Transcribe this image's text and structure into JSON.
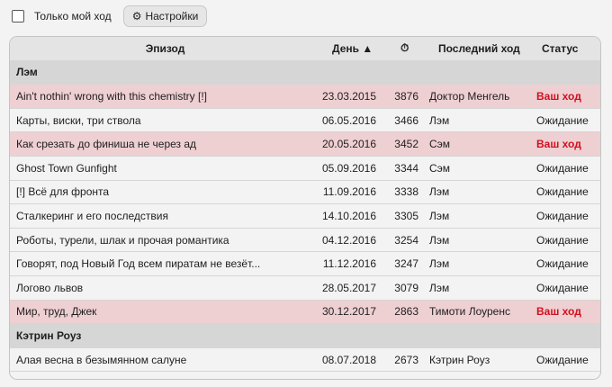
{
  "toolbar": {
    "only_my_turn_label": "Только мой ход",
    "settings_label": "Настройки"
  },
  "columns": {
    "episode": "Эпизод",
    "day": "День",
    "sort_indicator": "▲",
    "timer_icon": "⏱",
    "last_move": "Последний ход",
    "status": "Статус"
  },
  "groups": [
    {
      "name": "Лэм",
      "rows": [
        {
          "episode": "Ain't nothin' wrong with this chemistry [!]",
          "day": "23.03.2015",
          "num": "3876",
          "last": "Доктор Менгель",
          "status": "Ваш ход",
          "mine": true
        },
        {
          "episode": "Карты, виски, три ствола",
          "day": "06.05.2016",
          "num": "3466",
          "last": "Лэм",
          "status": "Ожидание",
          "mine": false
        },
        {
          "episode": "Как срезать до финиша не через ад",
          "day": "20.05.2016",
          "num": "3452",
          "last": "Сэм",
          "status": "Ваш ход",
          "mine": true
        },
        {
          "episode": "Ghost Town Gunfight",
          "day": "05.09.2016",
          "num": "3344",
          "last": "Сэм",
          "status": "Ожидание",
          "mine": false
        },
        {
          "episode": "[!] Всё для фронта",
          "day": "11.09.2016",
          "num": "3338",
          "last": "Лэм",
          "status": "Ожидание",
          "mine": false
        },
        {
          "episode": "Сталкеринг и его последствия",
          "day": "14.10.2016",
          "num": "3305",
          "last": "Лэм",
          "status": "Ожидание",
          "mine": false
        },
        {
          "episode": "Роботы, турели, шлак и прочая романтика",
          "day": "04.12.2016",
          "num": "3254",
          "last": "Лэм",
          "status": "Ожидание",
          "mine": false
        },
        {
          "episode": "Говорят, под Новый Год всем пиратам не везёт...",
          "day": "11.12.2016",
          "num": "3247",
          "last": "Лэм",
          "status": "Ожидание",
          "mine": false
        },
        {
          "episode": "Логово львов",
          "day": "28.05.2017",
          "num": "3079",
          "last": "Лэм",
          "status": "Ожидание",
          "mine": false
        },
        {
          "episode": "Мир, труд, Джек",
          "day": "30.12.2017",
          "num": "2863",
          "last": "Тимоти Лоуренс",
          "status": "Ваш ход",
          "mine": true
        }
      ]
    },
    {
      "name": "Кэтрин Роуз",
      "rows": [
        {
          "episode": "Алая весна в безымянном салуне",
          "day": "08.07.2018",
          "num": "2673",
          "last": "Кэтрин Роуз",
          "status": "Ожидание",
          "mine": false
        }
      ]
    }
  ]
}
